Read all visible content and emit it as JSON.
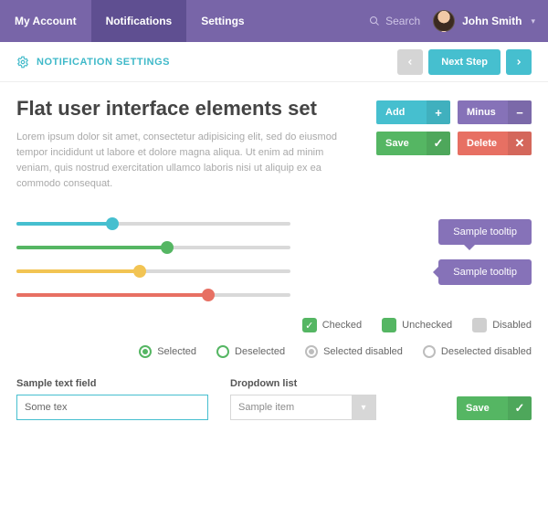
{
  "topbar": {
    "nav": [
      "My Account",
      "Notifications",
      "Settings"
    ],
    "active_index": 1,
    "search": "Search",
    "user_name": "John Smith"
  },
  "strip": {
    "title": "NOTIFICATION SETTINGS",
    "next": "Next Step"
  },
  "heading": "Flat user interface elements set",
  "lorem": "Lorem ipsum dolor sit amet, consectetur adipisicing elit, sed do eiusmod tempor incididunt ut labore et dolore magna aliqua. Ut enim ad minim veniam, quis nostrud exercitation ullamco laboris nisi ut aliquip ex ea commodo consequat.",
  "buttons": {
    "add": "Add",
    "minus": "Minus",
    "save": "Save",
    "delete": "Delete"
  },
  "sliders": [
    {
      "color": "c-teal",
      "pct": 35
    },
    {
      "color": "c-green",
      "pct": 55
    },
    {
      "color": "c-yellow",
      "pct": 45
    },
    {
      "color": "c-red",
      "pct": 70
    }
  ],
  "tooltips": {
    "t1": "Sample tooltip",
    "t2": "Sample tooltip"
  },
  "checks": {
    "checked": "Checked",
    "unchecked": "Unchecked",
    "disabled": "Disabled"
  },
  "radios": {
    "sel": "Selected",
    "desel": "Deselected",
    "seldis": "Selected disabled",
    "deseldis": "Deselected disabled"
  },
  "form": {
    "text_label": "Sample text field",
    "text_value": "Some tex",
    "dd_label": "Dropdown list",
    "dd_value": "Sample item",
    "save": "Save"
  }
}
